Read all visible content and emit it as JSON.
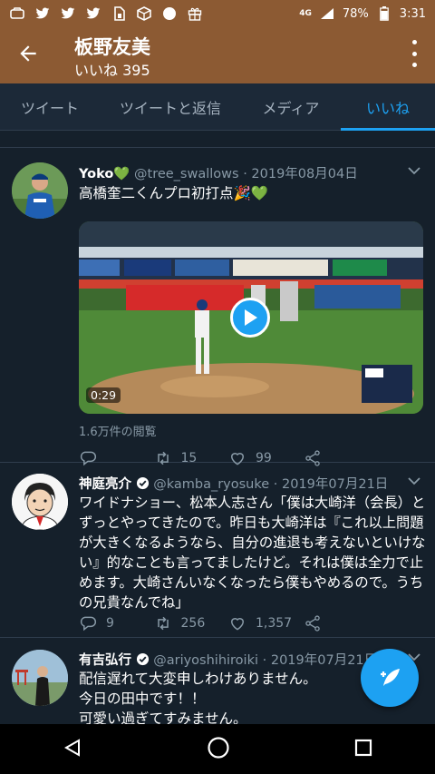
{
  "status": {
    "network": "4G",
    "battery": "78%",
    "time": "3:31"
  },
  "header": {
    "title": "板野友美",
    "subtitle": "いいね 395"
  },
  "tabs": [
    {
      "label": "ツイート"
    },
    {
      "label": "ツイートと返信"
    },
    {
      "label": "メディア"
    },
    {
      "label": "いいね"
    }
  ],
  "tweets": [
    {
      "name": "Yoko💚",
      "handle": "@tree_swallows",
      "date": "· 2019年08月04日",
      "text": "高橋奎二くんプロ初打点🎉💚",
      "video_duration": "0:29",
      "views": "1.6万件の閲覧",
      "replies": "",
      "retweets": "15",
      "likes": "99"
    },
    {
      "name": "神庭亮介",
      "handle": "@kamba_ryosuke",
      "date": "· 2019年07月21日",
      "text": "ワイドナショー、松本人志さん「僕は大崎洋（会長）とずっとやってきたので。昨日も大崎洋は『これ以上問題が大きくなるようなら、自分の進退も考えないといけない』的なことも言ってましたけど。それは僕は全力で止めます。大崎さんいなくなったら僕もやめるので。うちの兄貴なんでね」",
      "replies": "9",
      "retweets": "256",
      "likes": "1,357"
    },
    {
      "name": "有吉弘行",
      "handle": "@ariyoshihiroiki",
      "date": "· 2019年07月21日",
      "text_lines": [
        "配信遅れて大変申しわけありません。",
        "今日の田中です！！",
        "可愛い過ぎてすみません。"
      ]
    }
  ],
  "colors": {
    "accent": "#1da1f2",
    "header": "#8c5a33",
    "background": "#15202b"
  }
}
